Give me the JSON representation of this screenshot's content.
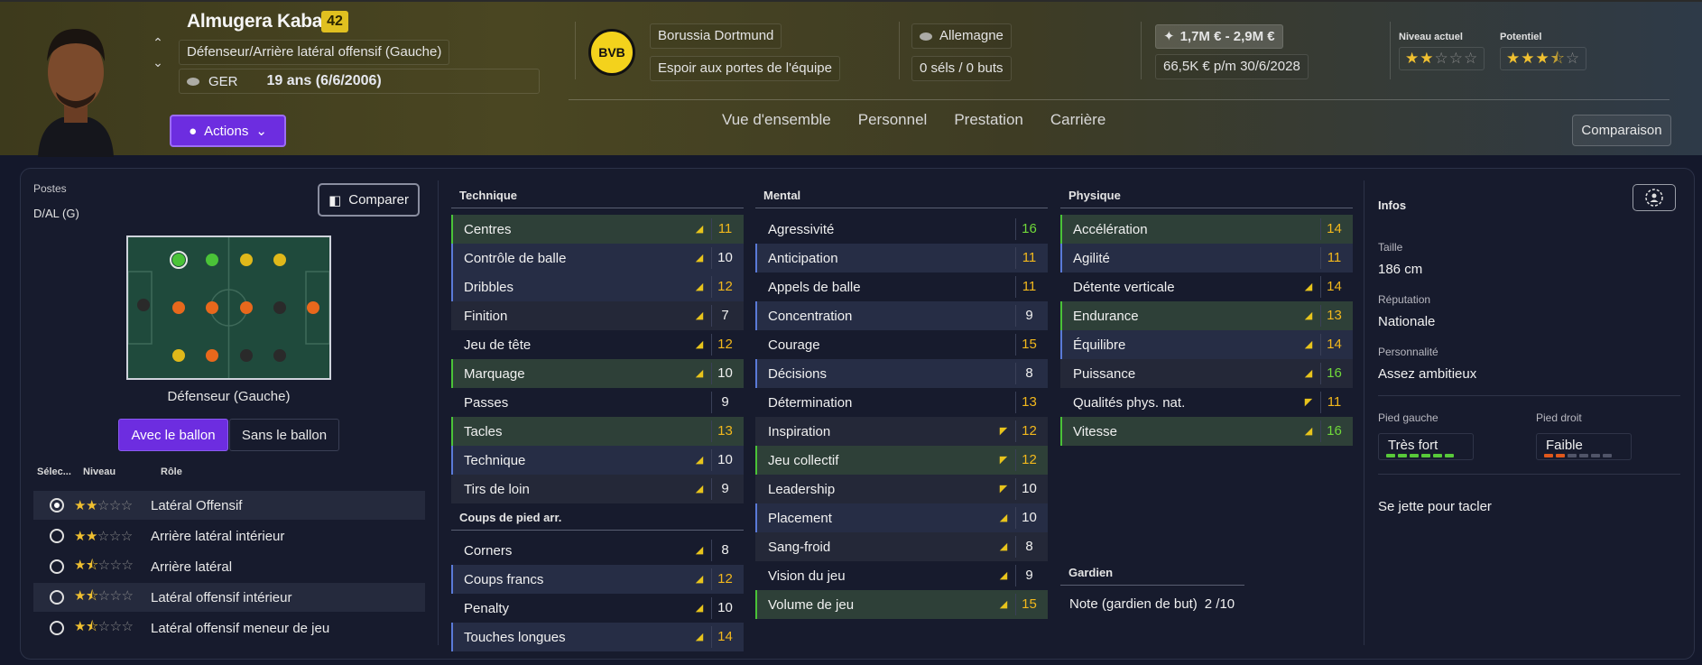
{
  "header": {
    "player_name": "Almugera Kabar",
    "player_number": "42",
    "position_desc": "Défenseur/Arrière latéral offensif (Gauche)",
    "nationality_code": "GER",
    "age": "19 ans (6/6/2006)",
    "club": "Borussia Dortmund",
    "club_crest": "BVB",
    "club_status": "Espoir aux portes de l'équipe",
    "country": "Allemagne",
    "caps": "0 séls / 0 buts",
    "value": "1,7M € - 2,9M €",
    "wage": "66,5K € p/m",
    "contract_end": "30/6/2028",
    "current_level_label": "Niveau actuel",
    "potential_label": "Potentiel",
    "current_level_stars": 2,
    "potential_stars": 3.5,
    "actions_label": "Actions",
    "tabs": [
      "Vue d'ensemble",
      "Personnel",
      "Prestation",
      "Carrière"
    ],
    "compare_label": "Comparaison"
  },
  "positions": {
    "label": "Postes",
    "value": "D/AL (G)",
    "compare_button": "Comparer",
    "pitch_caption": "Défenseur (Gauche)",
    "toggle_with_ball": "Avec le ballon",
    "toggle_without_ball": "Sans le ballon",
    "col_select": "Sélec...",
    "col_level": "Niveau",
    "col_role": "Rôle",
    "roles": [
      {
        "name": "Latéral Offensif",
        "stars": 2,
        "selected": true
      },
      {
        "name": "Arrière latéral intérieur",
        "stars": 2,
        "selected": false
      },
      {
        "name": "Arrière latéral",
        "stars": 1.5,
        "selected": false
      },
      {
        "name": "Latéral offensif intérieur",
        "stars": 1.5,
        "selected": false
      },
      {
        "name": "Latéral offensif meneur de jeu",
        "stars": 1.5,
        "selected": false
      }
    ]
  },
  "attributes": {
    "technique_title": "Technique",
    "technique": [
      {
        "name": "Centres",
        "value": 11,
        "hl": "g",
        "arrow": "up"
      },
      {
        "name": "Contrôle de balle",
        "value": 10,
        "hl": "b",
        "arrow": "up"
      },
      {
        "name": "Dribbles",
        "value": 12,
        "hl": "b",
        "arrow": "up"
      },
      {
        "name": "Finition",
        "value": 7,
        "hl": "",
        "arrow": "up"
      },
      {
        "name": "Jeu de tête",
        "value": 12,
        "hl": "",
        "arrow": "up"
      },
      {
        "name": "Marquage",
        "value": 10,
        "hl": "g",
        "arrow": "up"
      },
      {
        "name": "Passes",
        "value": 9,
        "hl": "",
        "arrow": ""
      },
      {
        "name": "Tacles",
        "value": 13,
        "hl": "g",
        "arrow": ""
      },
      {
        "name": "Technique",
        "value": 10,
        "hl": "b",
        "arrow": "up"
      },
      {
        "name": "Tirs de loin",
        "value": 9,
        "hl": "",
        "arrow": "up"
      }
    ],
    "setpieces_title": "Coups de pied arr.",
    "setpieces": [
      {
        "name": "Corners",
        "value": 8,
        "hl": "",
        "arrow": "up"
      },
      {
        "name": "Coups francs",
        "value": 12,
        "hl": "b",
        "arrow": "up"
      },
      {
        "name": "Penalty",
        "value": 10,
        "hl": "",
        "arrow": "up"
      },
      {
        "name": "Touches longues",
        "value": 14,
        "hl": "b",
        "arrow": "up"
      }
    ],
    "mental_title": "Mental",
    "mental": [
      {
        "name": "Agressivité",
        "value": 16,
        "hl": "",
        "arrow": ""
      },
      {
        "name": "Anticipation",
        "value": 11,
        "hl": "b",
        "arrow": ""
      },
      {
        "name": "Appels de balle",
        "value": 11,
        "hl": "",
        "arrow": ""
      },
      {
        "name": "Concentration",
        "value": 9,
        "hl": "b",
        "arrow": ""
      },
      {
        "name": "Courage",
        "value": 15,
        "hl": "",
        "arrow": ""
      },
      {
        "name": "Décisions",
        "value": 8,
        "hl": "b",
        "arrow": ""
      },
      {
        "name": "Détermination",
        "value": 13,
        "hl": "",
        "arrow": ""
      },
      {
        "name": "Inspiration",
        "value": 12,
        "hl": "",
        "arrow": "dn"
      },
      {
        "name": "Jeu collectif",
        "value": 12,
        "hl": "g",
        "arrow": "dn"
      },
      {
        "name": "Leadership",
        "value": 10,
        "hl": "",
        "arrow": "dn"
      },
      {
        "name": "Placement",
        "value": 10,
        "hl": "b",
        "arrow": "up"
      },
      {
        "name": "Sang-froid",
        "value": 8,
        "hl": "",
        "arrow": "up"
      },
      {
        "name": "Vision du jeu",
        "value": 9,
        "hl": "",
        "arrow": "up"
      },
      {
        "name": "Volume de jeu",
        "value": 15,
        "hl": "g",
        "arrow": "up"
      }
    ],
    "physical_title": "Physique",
    "physical": [
      {
        "name": "Accélération",
        "value": 14,
        "hl": "g",
        "arrow": ""
      },
      {
        "name": "Agilité",
        "value": 11,
        "hl": "b",
        "arrow": ""
      },
      {
        "name": "Détente verticale",
        "value": 14,
        "hl": "",
        "arrow": "up"
      },
      {
        "name": "Endurance",
        "value": 13,
        "hl": "g",
        "arrow": "up"
      },
      {
        "name": "Équilibre",
        "value": 14,
        "hl": "b",
        "arrow": "up"
      },
      {
        "name": "Puissance",
        "value": 16,
        "hl": "",
        "arrow": "up"
      },
      {
        "name": "Qualités phys. nat.",
        "value": 11,
        "hl": "",
        "arrow": "dn"
      },
      {
        "name": "Vitesse",
        "value": 16,
        "hl": "g",
        "arrow": "up"
      }
    ],
    "goalkeeper_title": "Gardien",
    "goalkeeper_note": "Note (gardien de but)",
    "goalkeeper_value": "2 /10"
  },
  "infos": {
    "title": "Infos",
    "height_label": "Taille",
    "height": "186 cm",
    "reputation_label": "Réputation",
    "reputation": "Nationale",
    "personality_label": "Personnalité",
    "personality": "Assez ambitieux",
    "left_foot_label": "Pied gauche",
    "left_foot": "Très fort",
    "left_foot_level": 6,
    "right_foot_label": "Pied droit",
    "right_foot": "Faible",
    "right_foot_level": 2,
    "trait": "Se jette pour tacler"
  }
}
